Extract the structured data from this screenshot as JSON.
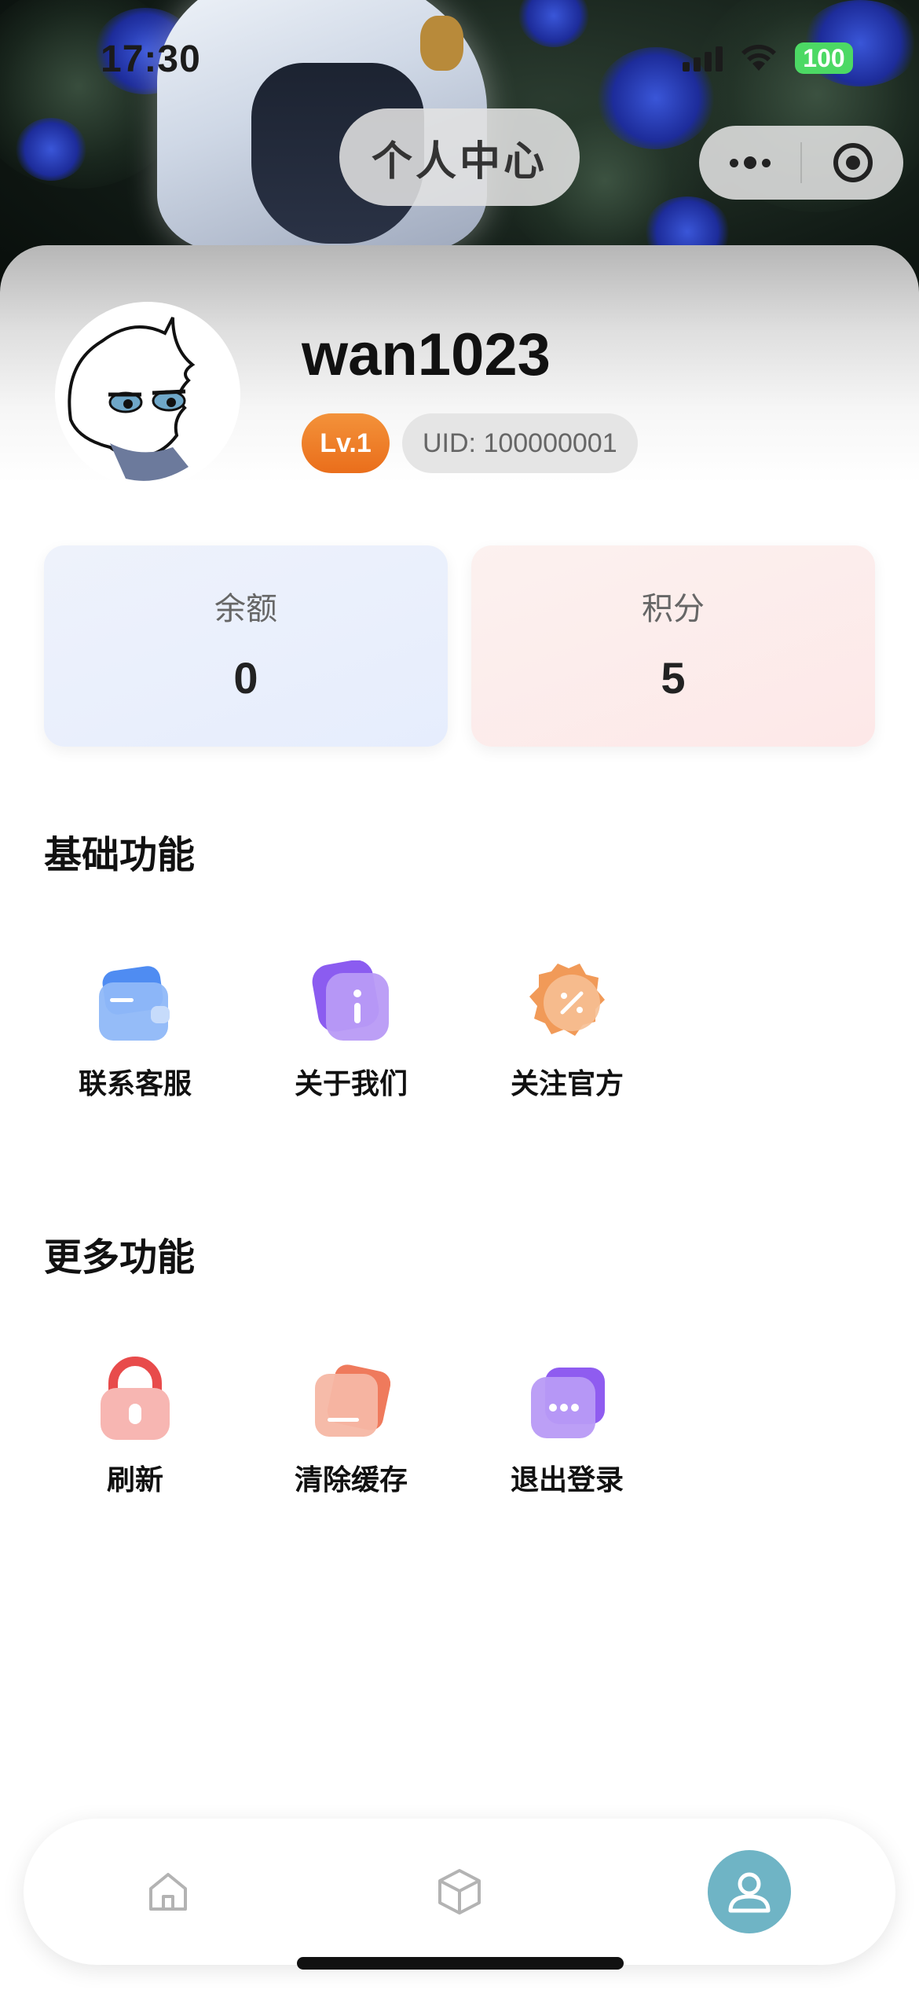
{
  "status_bar": {
    "time": "17:30",
    "battery": "100"
  },
  "nav": {
    "title": "个人中心"
  },
  "profile": {
    "username": "wan1023",
    "level": "Lv.1",
    "uid": "UID: 100000001"
  },
  "stats": [
    {
      "label": "余额",
      "value": "0"
    },
    {
      "label": "积分",
      "value": "5"
    }
  ],
  "sections": [
    {
      "title": "基础功能",
      "items": [
        {
          "label": "联系客服",
          "icon": "wallet-icon"
        },
        {
          "label": "关于我们",
          "icon": "info-icon"
        },
        {
          "label": "关注官方",
          "icon": "discount-badge-icon"
        }
      ]
    },
    {
      "title": "更多功能",
      "items": [
        {
          "label": "刷新",
          "icon": "lock-icon"
        },
        {
          "label": "清除缓存",
          "icon": "cards-icon"
        },
        {
          "label": "退出登录",
          "icon": "chat-bubble-icon"
        }
      ]
    }
  ],
  "tabbar": {
    "tabs": [
      {
        "icon": "home-icon"
      },
      {
        "icon": "box-icon"
      },
      {
        "icon": "user-icon",
        "active": true
      }
    ],
    "active_color": "#6fb4c5"
  },
  "colors": {
    "level_badge": "#ea6e1b",
    "balance_card": "#e6edfd",
    "points_card": "#fde8e8"
  }
}
